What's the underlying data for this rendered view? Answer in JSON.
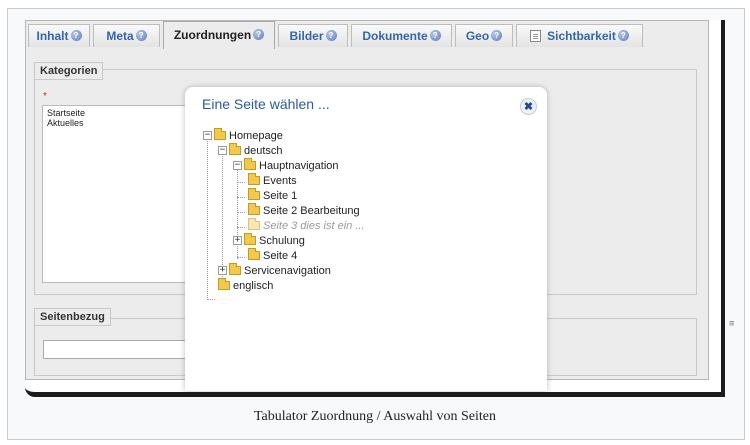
{
  "tabs": [
    {
      "label": "Inhalt",
      "active": false
    },
    {
      "label": "Meta",
      "active": false
    },
    {
      "label": "Zuordnungen",
      "active": true
    },
    {
      "label": "Bilder",
      "active": false
    },
    {
      "label": "Dokumente",
      "active": false
    },
    {
      "label": "Geo",
      "active": false
    },
    {
      "label": "Sichtbarkeit",
      "active": false
    }
  ],
  "help_glyph": "?",
  "kategorien": {
    "legend": "Kategorien",
    "required_marker": "*",
    "items": [
      "Startseite",
      "Aktuelles"
    ]
  },
  "seitenbezug": {
    "legend": "Seitenbezug",
    "value": ""
  },
  "dialog": {
    "title": "Eine Seite wählen ...",
    "close_glyph": "✖",
    "tree": {
      "homepage": "Homepage",
      "deutsch": "deutsch",
      "hauptnavigation": "Hauptnavigation",
      "events": "Events",
      "seite1": "Seite 1",
      "seite2": "Seite 2 Bearbeitung",
      "seite3": "Seite 3 dies ist ein ...",
      "schulung": "Schulung",
      "seite4": "Seite 4",
      "servicenavigation": "Servicenavigation",
      "englisch": "englisch"
    },
    "expanded_glyph": "−",
    "collapsed_glyph": "+"
  },
  "resize_glyph": "≡",
  "caption": "Tabulator Zuordnung / Auswahl von Seiten",
  "colors": {
    "tab_text": "#3366aa",
    "dialog_title": "#2a5b9c",
    "folder": "#f2c94c"
  }
}
